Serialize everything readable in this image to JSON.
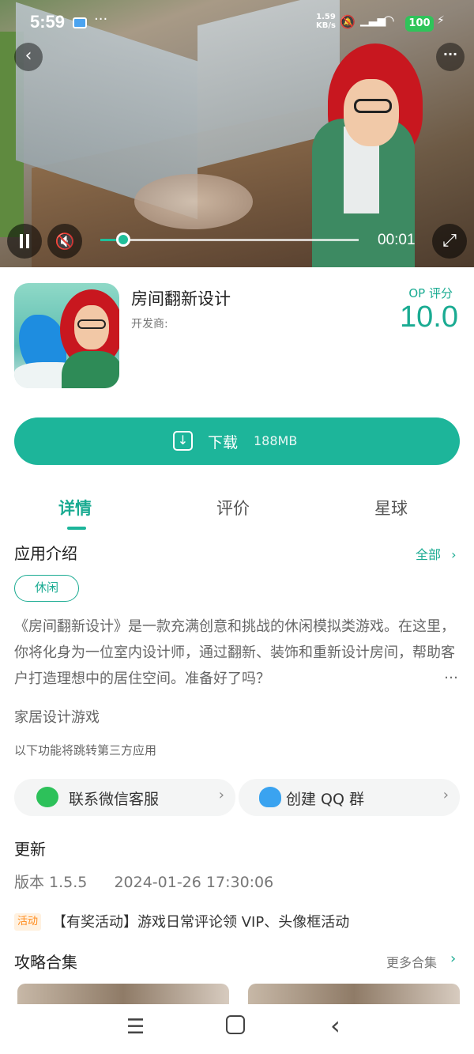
{
  "status_bar": {
    "time": "5:59",
    "dots": "···",
    "net_speed_value": "1.59",
    "net_speed_unit": "KB/s",
    "battery": "100",
    "battery_color": "#2fc45a"
  },
  "video": {
    "progress_fraction": 0.09,
    "time": "00:01",
    "playing": true,
    "muted": true
  },
  "app": {
    "title": "房间翻新设计",
    "developer_label": "开发商:",
    "score_label": "OP 评分",
    "score": "10.0",
    "download_label": "下载",
    "download_size": "188MB"
  },
  "tabs": [
    {
      "label": "详情",
      "active": true
    },
    {
      "label": "评价",
      "active": false
    },
    {
      "label": "星球",
      "active": false
    }
  ],
  "intro": {
    "title": "应用介绍",
    "all_label": "全部",
    "tag": "休闲",
    "description": "《房间翻新设计》是一款充满创意和挑战的休闲模拟类游戏。在这里，你将化身为一位室内设计师，通过翻新、装饰和重新设计房间，帮助客户打造理想中的居住空间。准备好了吗？",
    "ellipsis": "…",
    "genre": "家居设计游戏",
    "third_party_note": "以下功能将跳转第三方应用"
  },
  "contacts": {
    "wechat_label": "联系微信客服",
    "qq_label": "创建 QQ 群"
  },
  "update": {
    "title": "更新",
    "version": "版本 1.5.5",
    "date": "2024-01-26 17:30:06"
  },
  "event": {
    "badge": "活动",
    "text": "【有奖活动】游戏日常评论领 VIP、头像框活动"
  },
  "guides": {
    "title": "攻略合集",
    "more_label": "更多合集"
  },
  "colors": {
    "accent": "#1db59a",
    "accent_text": "#1aab92",
    "event_orange": "#ff8a1a"
  },
  "icons": {
    "back": "chevron-left-icon",
    "more": "more-horizontal-icon",
    "pause": "pause-icon",
    "mute": "volume-mute-icon",
    "fullscreen": "fullscreen-icon",
    "download": "download-icon",
    "wechat": "wechat-icon",
    "qq": "qq-icon"
  }
}
